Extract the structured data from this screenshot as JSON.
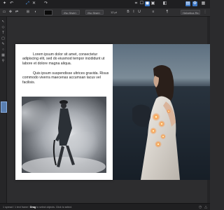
{
  "toolbar": {
    "left_icons": [
      "persona-icon",
      "undo-icon",
      "redo-icon",
      "transform-icon",
      "grid-icon"
    ],
    "right_icons": [
      "snap-icon",
      "align-icon",
      "arrange-icon",
      "share-icon",
      "view-mode-icon",
      "preview-icon",
      "settings-icon"
    ]
  },
  "context": {
    "font_family": "(No Style)",
    "font_style": "(No Style)",
    "font_size": "12 pt",
    "style": "Helvetica Re...",
    "color_label": "Fill"
  },
  "document": {
    "paragraph_1": "Lorem ipsum dolor sit amet, consectetur adipiscing elit, sed do eiusmod tempor incididunt ut labore et dolore magna aliqua.",
    "paragraph_2": "Quis ipsum suspendisse ultrices gravida. Risus commodo viverra maecenas accumsan lacus vel facilisis."
  },
  "status": {
    "prefix": "1 spread / 1 text frame /",
    "keyword": "Drag",
    "suffix": "to select objects. Click to select."
  },
  "colors": {
    "accent": "#3c78c7",
    "toolbar_bg": "#1f1f21",
    "canvas_bg": "#2d2d2f",
    "page_bg": "#ffffff"
  }
}
